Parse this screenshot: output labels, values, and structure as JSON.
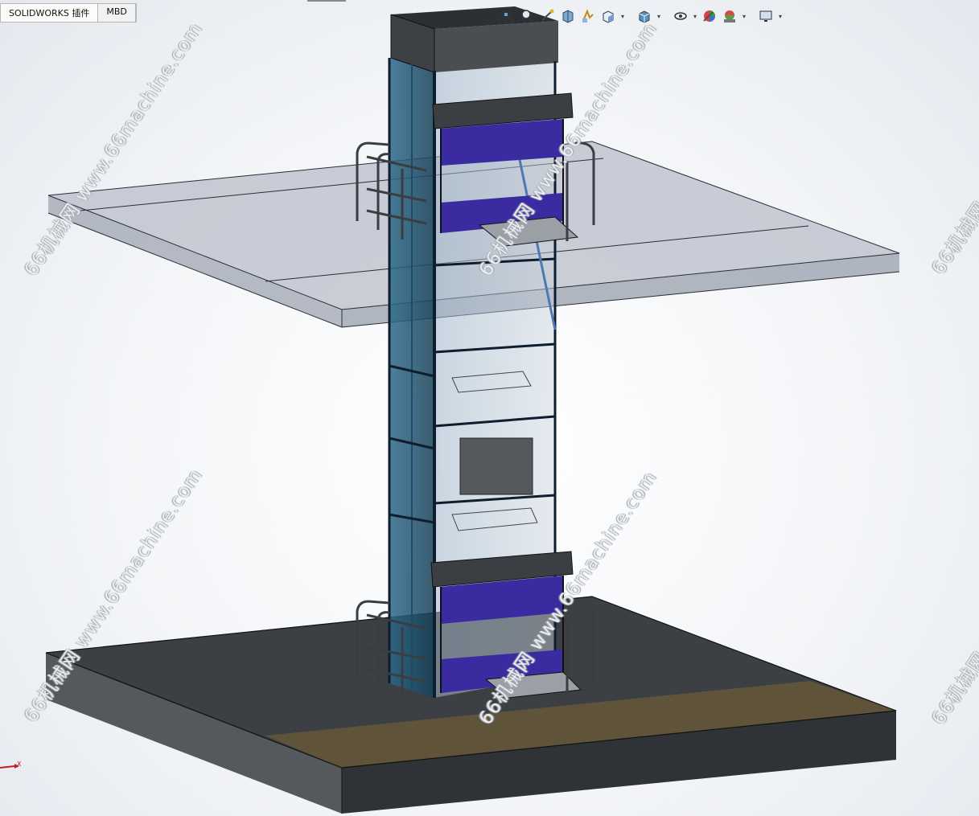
{
  "tabs": [
    {
      "label": "SOLIDWORKS 插件"
    },
    {
      "label": "MBD"
    }
  ],
  "toolbar": {
    "icons": [
      "zoom-to-fit-icon",
      "zoom-to-area-icon",
      "previous-view-icon",
      "section-view-icon",
      "dynamic-annotation-icon",
      "view-orientation-icon",
      "display-style-icon",
      "hide-show-items-icon",
      "edit-appearance-icon",
      "apply-scene-icon",
      "view-settings-icon"
    ]
  },
  "viewport": {
    "triad_axis_label": "X"
  },
  "watermark": {
    "text": "66机械网 www.66machine.com"
  },
  "colors": {
    "slab": "#b9bec9",
    "tower_frame": "#1e3f63",
    "door_panel": "#3a2ca0",
    "ground_top": "#3c3f43",
    "walkway": "#5f5439"
  }
}
